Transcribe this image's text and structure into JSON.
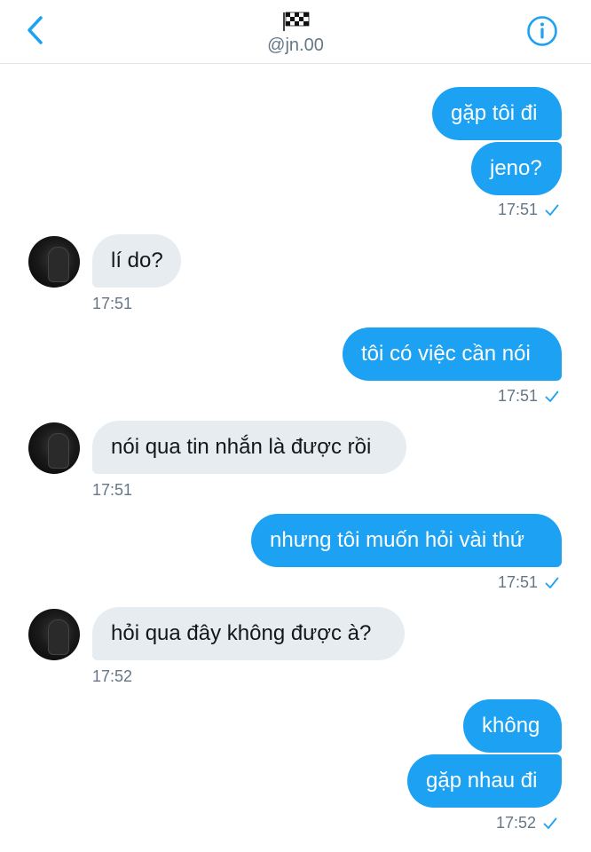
{
  "header": {
    "handle": "@jn.00",
    "back_icon": "chevron-left-icon",
    "info_icon": "info-icon",
    "flag_icon": "checkered-flag-icon",
    "accent": "#1da1f2"
  },
  "messages": [
    {
      "text": "gặp tôi đi",
      "direction": "sent"
    },
    {
      "text": "jeno?",
      "direction": "sent",
      "time": "17:51",
      "read": true
    },
    {
      "text": "lí do?",
      "direction": "received",
      "time": "17:51"
    },
    {
      "text": "tôi có việc cần nói",
      "direction": "sent",
      "time": "17:51",
      "read": true
    },
    {
      "text": "nói qua tin nhắn là được rồi",
      "direction": "received",
      "time": "17:51"
    },
    {
      "text": "nhưng tôi muốn hỏi vài thứ",
      "direction": "sent",
      "time": "17:51",
      "read": true
    },
    {
      "text": "hỏi qua đây không được à?",
      "direction": "received",
      "time": "17:52"
    },
    {
      "text": "không",
      "direction": "sent"
    },
    {
      "text": "gặp nhau đi",
      "direction": "sent",
      "time": "17:52",
      "read": true
    }
  ]
}
